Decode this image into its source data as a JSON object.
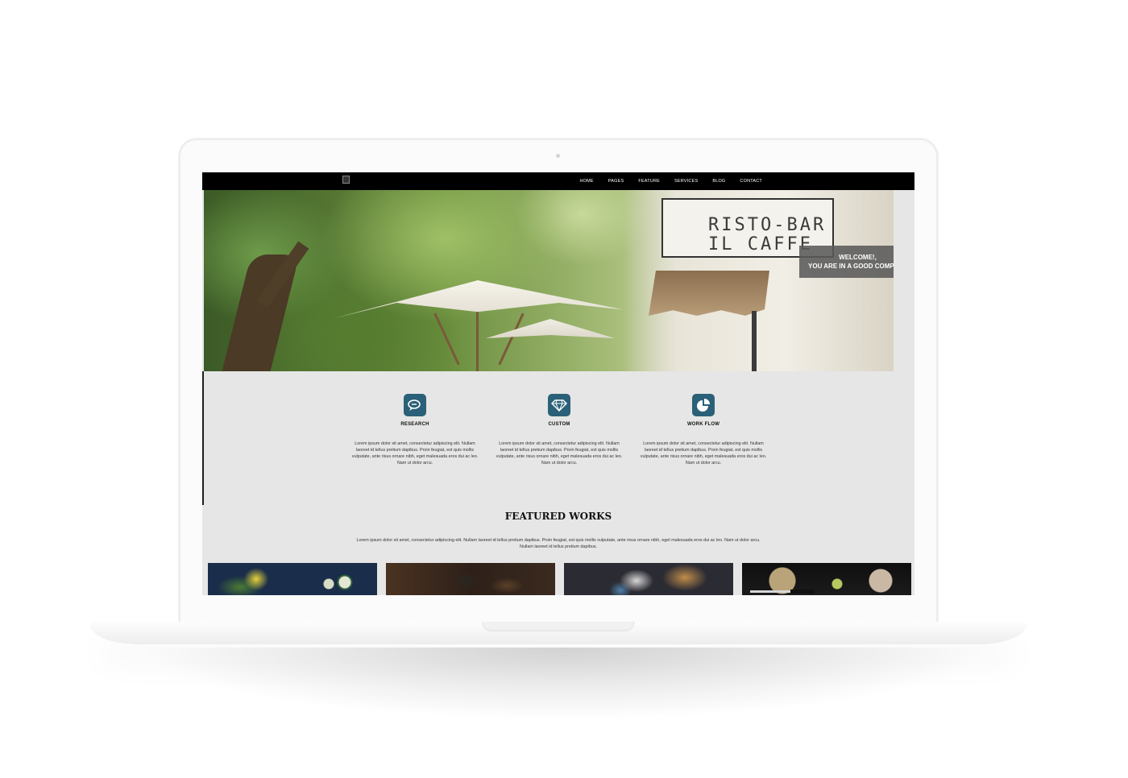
{
  "nav": {
    "items": [
      "HOME",
      "PAGES",
      "FEATURE",
      "SERVICES",
      "BLOG",
      "CONTACT"
    ]
  },
  "hero": {
    "awning_text_line1": "RISTO-BAR",
    "awning_text_line2": "IL CAFFE",
    "welcome_line1": "WELCOME!,",
    "welcome_line2": "YOU ARE IN A GOOD COMPANY"
  },
  "features": [
    {
      "icon": "speech-bubbles-icon",
      "title": "RESEARCH",
      "text": "Lorem ipsum dolor sit amet, consectetur adipiscing elit. Nullam laoreet id tellus pretium dapibus. Proin feugiat, est quis mollis vulputate, ante risus ornare nibh, eget malesuada eros dui ac leo. Nam ut dolor arcu."
    },
    {
      "icon": "diamond-icon",
      "title": "CUSTOM",
      "text": "Lorem ipsum dolor sit amet, consectetur adipiscing elit. Nullam laoreet id tellus pretium dapibus. Proin feugiat, est quis mollis vulputate, ante risus ornare nibh, eget malesuada eros dui ac leo. Nam ut dolor arcu."
    },
    {
      "icon": "pie-chart-icon",
      "title": "WORK FLOW",
      "text": "Lorem ipsum dolor sit amet, consectetur adipiscing elit. Nullam laoreet id tellus pretium dapibus. Proin feugiat, est quis mollis vulputate, ante risus ornare nibh, eget malesuada eros dui ac leo. Nam ut dolor arcu."
    }
  ],
  "featured": {
    "title": "FEATURED WORKS",
    "text": "Lorem ipsum dolor sit amet, consectetur adipiscing elit. Nullam laoreet id tellus pretium dapibus. Proin feugiat, est quis mollis vulputate, ante risus ornare nibh, eget malesuada eros dui ac leo. Nam ut dolor arcu. Nullam laoreet id tellus pretium dapibus."
  },
  "colors": {
    "icon_bg": "#2a6178",
    "topbar": "#000000",
    "page_bg": "#e6e6e6"
  }
}
